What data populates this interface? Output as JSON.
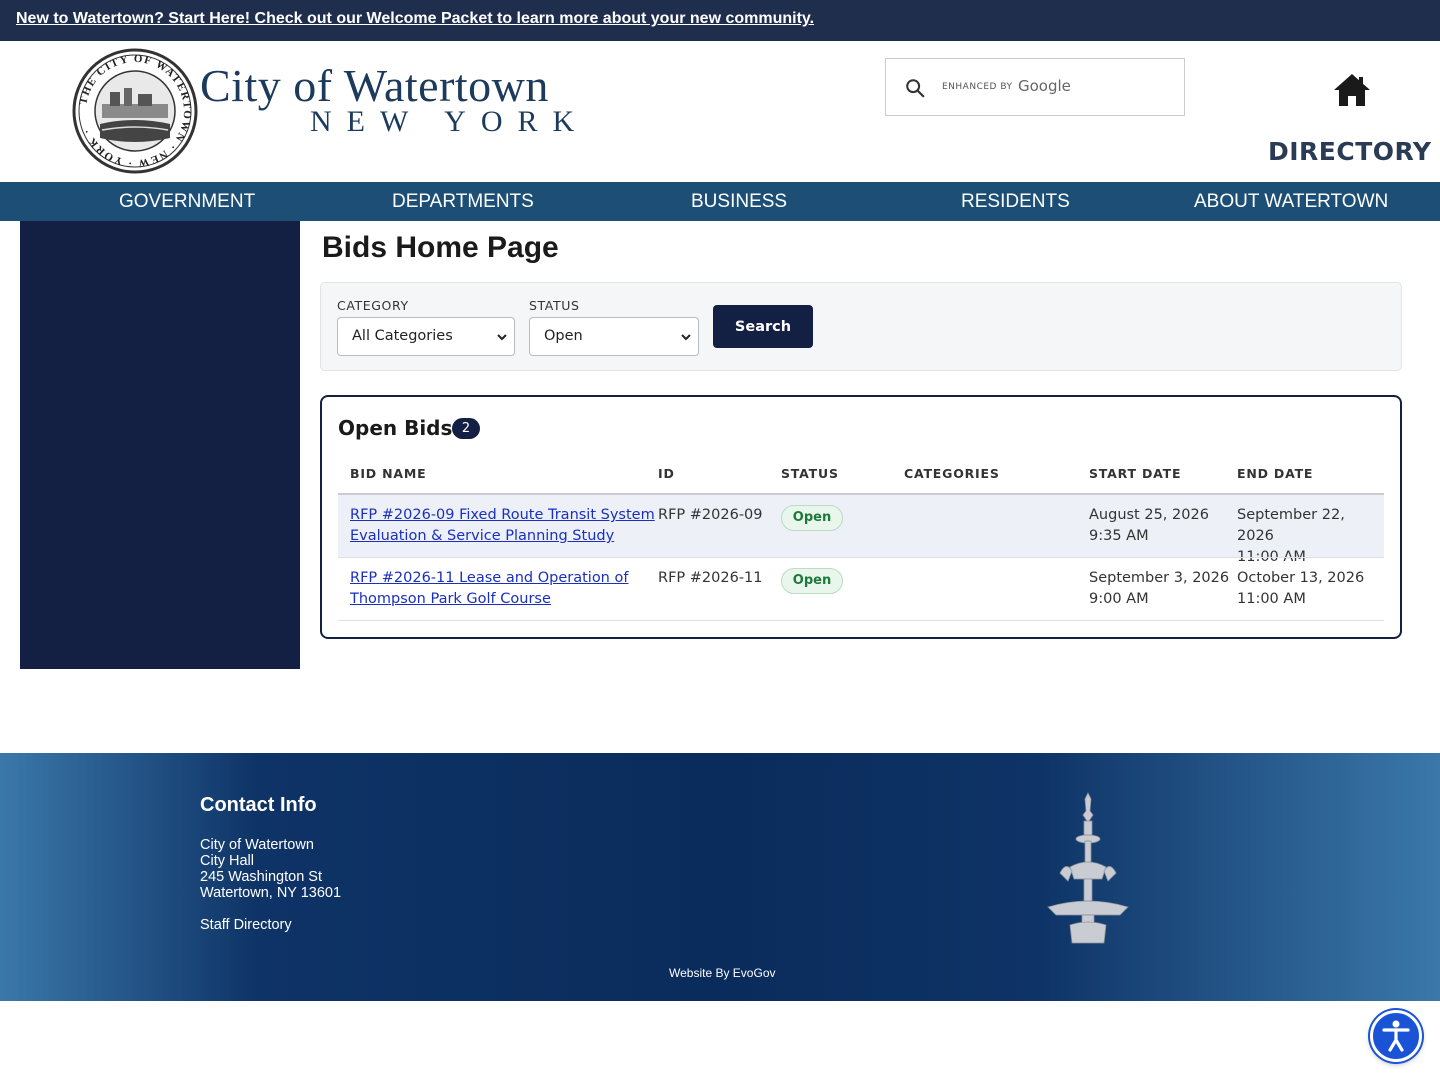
{
  "announcement": {
    "text": "New to Watertown? Start Here! Check out our Welcome Packet to learn more about your new community."
  },
  "header": {
    "title": "City of Watertown",
    "subtitle": "NEW YORK",
    "seal_text": "THE CITY OF WATERTOWN NEW YORK",
    "search": {
      "enhanced_by": "ENHANCED BY",
      "brand": "Google",
      "placeholder": ""
    },
    "directory_label": "DIRECTORY",
    "home_icon": "home-icon"
  },
  "nav": {
    "items": [
      "GOVERNMENT",
      "DEPARTMENTS",
      "BUSINESS",
      "RESIDENTS",
      "ABOUT WATERTOWN"
    ]
  },
  "main": {
    "title": "Bids Home Page",
    "filters": {
      "category_label": "CATEGORY",
      "category_value": "All Categories",
      "status_label": "STATUS",
      "status_value": "Open",
      "search_label": "Search"
    },
    "bids": {
      "title": "Open Bids",
      "count": "2",
      "columns": [
        "BID NAME",
        "ID",
        "STATUS",
        "CATEGORIES",
        "START DATE",
        "END DATE"
      ],
      "rows": [
        {
          "name_line1": "RFP #2026-09 Fixed Route Transit System",
          "name_line2": "Evaluation & Service Planning Study",
          "id": "RFP #2026-09",
          "status": "Open",
          "categories": "",
          "start_date": "August 25, 2026",
          "start_time": "9:35 AM",
          "end_date": "September 22, 2026",
          "end_time": "11:00 AM"
        },
        {
          "name_line1": "RFP #2026-11 Lease and Operation of",
          "name_line2": "Thompson Park Golf Course",
          "id": "RFP #2026-11",
          "status": "Open",
          "categories": "",
          "start_date": "September 3, 2026",
          "start_time": "9:00 AM",
          "end_date": "October 13, 2026",
          "end_time": "11:00 AM"
        }
      ]
    }
  },
  "footer": {
    "title": "Contact Info",
    "lines": [
      "City of Watertown",
      "City Hall",
      "245 Washington St",
      "Watertown, NY 13601"
    ],
    "staff_link": "Staff Directory",
    "credit": "Website By EvoGov"
  },
  "colors": {
    "navy": "#141f44",
    "nav_blue": "#1d4f76",
    "announce": "#1f2e4d",
    "link": "#1a2fbf",
    "open_green": "#1e7a3c"
  }
}
